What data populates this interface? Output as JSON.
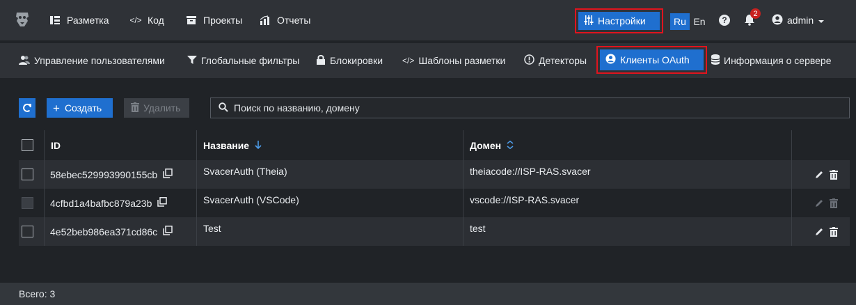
{
  "topnav": {
    "items": [
      {
        "label": "Разметка",
        "icon": "columns-icon"
      },
      {
        "label": "Код",
        "icon": "code-icon"
      },
      {
        "label": "Проекты",
        "icon": "archive-icon"
      },
      {
        "label": "Отчеты",
        "icon": "chart-icon"
      }
    ],
    "settings_label": "Настройки",
    "lang_ru": "Ru",
    "lang_en": "En",
    "help": "?",
    "notifications_count": "2",
    "user": "admin"
  },
  "subnav": {
    "items": [
      {
        "label": "Управление пользователями",
        "icon": "users-icon"
      },
      {
        "label": "Глобальные фильтры",
        "icon": "filter-icon"
      },
      {
        "label": "Блокировки",
        "icon": "lock-icon"
      },
      {
        "label": "Шаблоны разметки",
        "icon": "code-icon"
      },
      {
        "label": "Детекторы",
        "icon": "info-icon"
      },
      {
        "label": "Клиенты OAuth",
        "icon": "user-circle-icon"
      },
      {
        "label": "Информация о сервере",
        "icon": "database-icon"
      }
    ]
  },
  "toolbar": {
    "create_label": "Создать",
    "delete_label": "Удалить",
    "search_placeholder": "Поиск по названию, домену"
  },
  "table": {
    "columns": [
      "ID",
      "Название",
      "Домен"
    ],
    "sort": {
      "Название": "descending",
      "Домен": "unsorted"
    },
    "rows": [
      {
        "id": "58ebec529993990155cb",
        "name": "SvacerAuth (Theia)",
        "domain": "theiacode://ISP-RAS.svacer"
      },
      {
        "id": "4cfbd1a4bafbc879a23b",
        "name": "SvacerAuth (VSCode)",
        "domain": "vscode://ISP-RAS.svacer"
      },
      {
        "id": "4e52beb986ea371cd86c",
        "name": "Test",
        "domain": "test"
      }
    ]
  },
  "footer": {
    "total_label": "Всего: 3"
  },
  "colors": {
    "accent": "#1f6fcf",
    "highlight": "#e1141e",
    "background": "#202327",
    "panel": "#2f3237"
  }
}
